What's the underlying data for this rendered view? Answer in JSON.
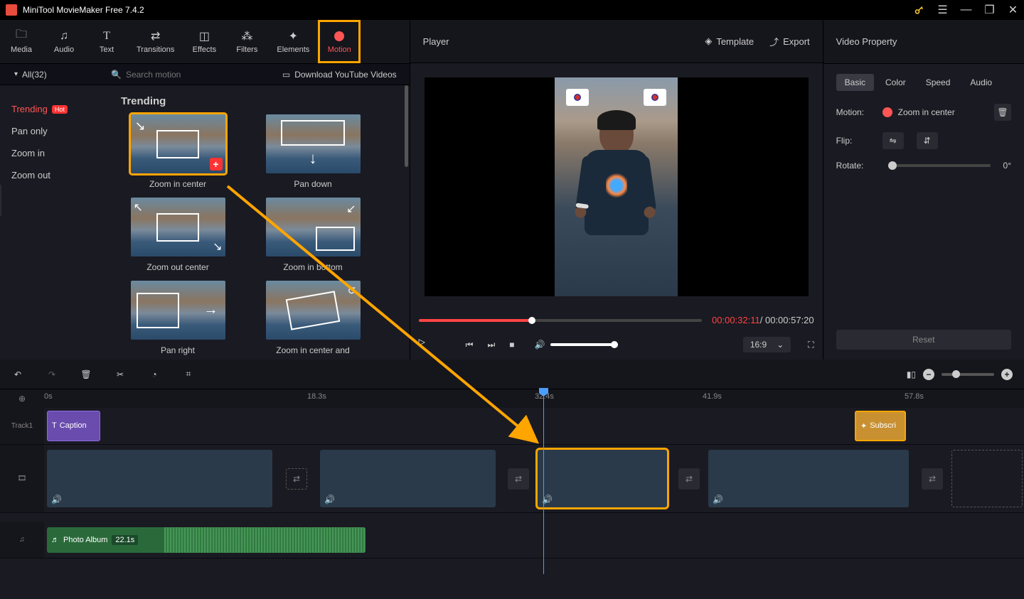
{
  "app": {
    "title": "MiniTool MovieMaker Free 7.4.2"
  },
  "tabs": {
    "media": "Media",
    "audio": "Audio",
    "text": "Text",
    "transitions": "Transitions",
    "effects": "Effects",
    "filters": "Filters",
    "elements": "Elements",
    "motion": "Motion"
  },
  "motion": {
    "all_label": "All(32)",
    "search_placeholder": "Search motion",
    "download_yt": "Download YouTube Videos",
    "heading": "Trending",
    "cats": {
      "trending": "Trending",
      "hot": "Hot",
      "pan_only": "Pan only",
      "zoom_in": "Zoom in",
      "zoom_out": "Zoom out"
    },
    "items": {
      "zoom_in_center": "Zoom in center",
      "pan_down": "Pan down",
      "zoom_out_center": "Zoom out center",
      "zoom_in_bottom": "Zoom in bottom",
      "pan_right": "Pan right",
      "zoom_in_center_and": "Zoom in center and"
    }
  },
  "player": {
    "title": "Player",
    "template": "Template",
    "export": "Export",
    "time_current": "00:00:32:11",
    "time_total": "00:00:57:20",
    "ratio": "16:9",
    "separator": " / "
  },
  "props": {
    "title": "Video Property",
    "tabs": {
      "basic": "Basic",
      "color": "Color",
      "speed": "Speed",
      "audio": "Audio"
    },
    "motion_label": "Motion:",
    "motion_value": "Zoom in center",
    "flip_label": "Flip:",
    "rotate_label": "Rotate:",
    "rotate_value": "0°",
    "reset": "Reset"
  },
  "timeline": {
    "marks": {
      "t0": "0s",
      "t1": "18.3s",
      "t2": "32.4s",
      "t3": "41.9s",
      "t4": "57.8s"
    },
    "track1_label": "Track1",
    "caption": "Caption",
    "subscribe": "Subscri",
    "audio_name": "Photo Album",
    "audio_dur": "22.1s"
  }
}
